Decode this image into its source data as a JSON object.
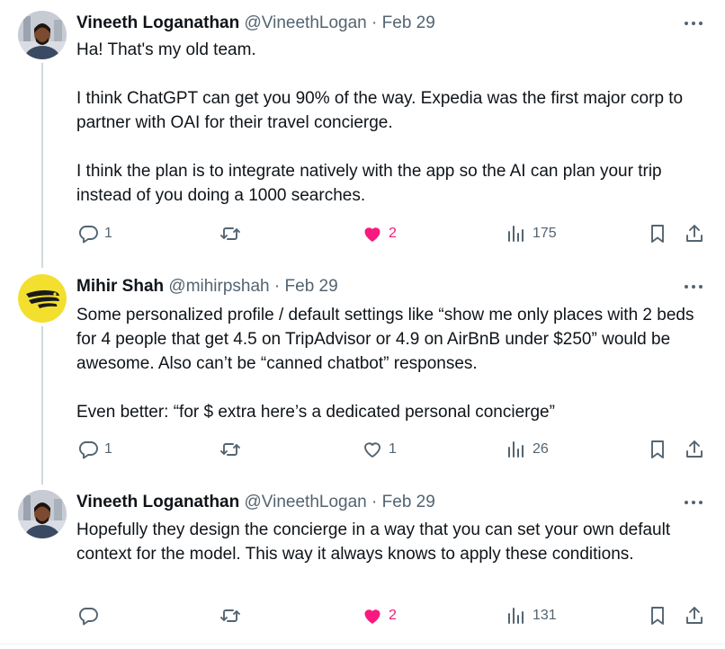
{
  "tweets": [
    {
      "name": "Vineeth Loganathan",
      "handle": "@VineethLogan",
      "separator": "·",
      "date": "Feb 29",
      "paragraphs": [
        "Ha! That's my old team.",
        "I think ChatGPT can get you 90% of the way. Expedia was the first major corp to partner with OAI for their travel concierge.",
        "I think the plan is to integrate natively with the app so the AI can plan your trip instead of you doing a 1000 searches."
      ],
      "replies": "1",
      "retweets": "",
      "likes": "2",
      "liked": true,
      "views": "175"
    },
    {
      "name": "Mihir Shah",
      "handle": "@mihirpshah",
      "separator": "·",
      "date": "Feb 29",
      "paragraphs": [
        "Some personalized profile / default settings like “show me only places with 2 beds for 4 people that get 4.5 on TripAdvisor or 4.9 on AirBnB under $250” would be awesome. Also can’t be “canned chatbot” responses.",
        "Even better: “for $ extra here’s a dedicated personal concierge”"
      ],
      "replies": "1",
      "retweets": "",
      "likes": "1",
      "liked": false,
      "views": "26"
    },
    {
      "name": "Vineeth Loganathan",
      "handle": "@VineethLogan",
      "separator": "·",
      "date": "Feb 29",
      "paragraphs": [
        "Hopefully they design the concierge in a way that you can set your own default context for the model. This way it always knows to apply these conditions."
      ],
      "replies": "",
      "retweets": "",
      "likes": "2",
      "liked": true,
      "views": "131"
    }
  ],
  "icons": {
    "more": "more-horizontal-icon",
    "reply": "reply-icon",
    "retweet": "retweet-icon",
    "like": "heart-icon",
    "views": "views-icon",
    "bookmark": "bookmark-icon",
    "share": "share-icon"
  },
  "colors": {
    "text": "#0f1419",
    "secondary": "#536471",
    "like": "#f91880",
    "thread_line": "#cfd9de",
    "mihir_avatar_bg": "#f2df2e"
  }
}
